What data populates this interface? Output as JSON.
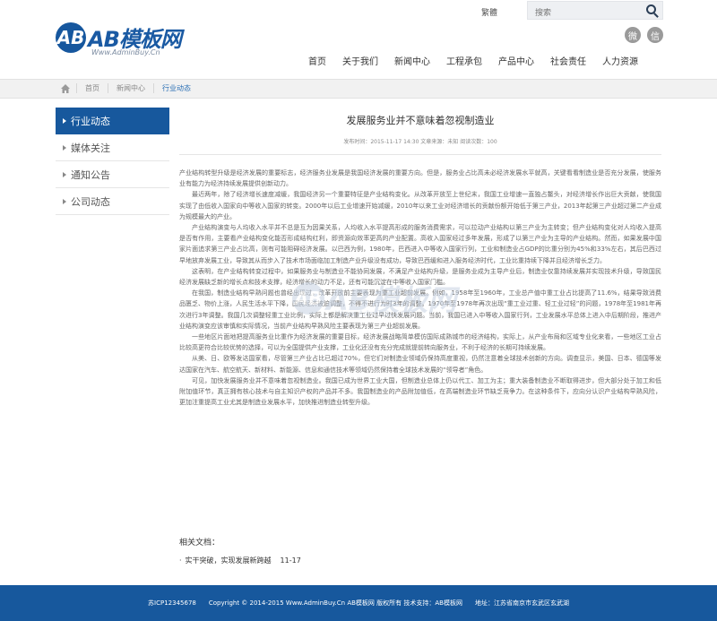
{
  "header": {
    "logo_letters": "AB",
    "logo_text": "AB模板网",
    "logo_sub": "Www.AdminBuy.Cn",
    "lang": "繁體",
    "search_placeholder": "搜索",
    "social_icons": [
      "weibo-icon",
      "wechat-icon"
    ],
    "nav": [
      "首页",
      "关于我们",
      "新闻中心",
      "工程承包",
      "产品中心",
      "社会责任",
      "人力资源"
    ]
  },
  "breadcrumb": [
    "首页",
    "新闻中心",
    "行业动态"
  ],
  "sidebar": {
    "items": [
      "行业动态",
      "媒体关注",
      "通知公告",
      "公司动态"
    ],
    "active_index": 0
  },
  "article": {
    "title": "发展服务业并不意味着忽视制造业",
    "meta": "发布时间：2015-11-17  14:30  文章来源：未知  阅读次数：100",
    "paragraphs": [
      "产业结构转型升级是经济发展的重要标志，经济服务业发展是我国经济发展的重要方向。但是，服务业占比高未必经济发展水平就高，关键看看制造业是否充分发展，使服务业有能力为经济持续发展提供创新动力。",
      "最近两年，除了经济增长速度减缓，我国经济另一个重要特征是产业结构变化。从改革开放至上世纪末，我国工业增速一直独占鳌头，对经济增长作出巨大贡献，使我国实现了由低收入国家向中等收入国家的转变。2000年以后工业增速开始减缓，2010年以来工业对经济增长的贡献份额开始低于第三产业，2013年起第三产业超过第二产业成为规模最大的产业。",
      "产业结构演变与人均收入水平并不总是互为因果关系，人均收入水平提高形成的服务消费需求，可以拉动产业结构以第三产业为主转变；但产业结构变化对人均收入提高是否有作用，主要看产业结构变化能否形成结构红利，即资源向效率更高的产业配置。高收入国家经过多年发展，形成了以第三产业为主导的产业结构。然而，如果发展中国家片面追求第三产业占比高，则有可能阻碍经济发展。以巴西为例，1980年，巴西进入中等收入国家行列，工业和制造业占GDP的比重分别为45%和33%左右，其后巴西过早地放弃发展工业，导致其从而步入了技术市场面临加工制造产业升级没有成功，导致巴西缓和进入服务经济时代，工业比重持续下降并且经济增长乏力。",
      "这表明，在产业结构转变过程中，如果服务业与制造业不能协同发展，不满足产业结构升级，是服务业成为主导产业后，制造业仅靠持续发展并实现技术升级，导致国民经济发展缺乏新的增长点和技术支撑，经济增长的动力不足，还有可能沉淀在中等收入国家门槛。",
      "在我国，制造业结构早熟问题也曾经出现过，改革开放前主要表现为重工业超前发展。例如，1958年至1960年，工业总产值中重工业占比提高了11.6%，结果导致消费品匮乏、物价上涨，人民生活水平下降，国民经济被迫调整，不得不进行为时3年的调整。1970年至1978年再次出现“重工业过重、轻工业过轻”的问题，1978年至1981年再次进行3年调整。我国几次调整轻重工业比例，实际上都是解决重工业过早过快发展问题。当前，我国已进入中等收入国家行列，工业发展水平总体上进入中后期阶段，推进产业结构演变应该审慎和实际情况，当前产业结构早熟风险主要表现为第三产业超前发展。",
      "一些地区片面地把提高服务业比重作为经济发展的重要目标，经济发展战略简单模仿国际成熟城市的经济结构，实际上，从产业布局和区域专业化来看，一些地区工业占比较高更符合比较优势的选择，可以为全国提供产业支撑，工业化还没有充分完成就提前转向服务业，不利于经济的长期可持续发展。",
      "从美、日、欧等发达国家看，尽管第三产业占比已超过70%，但它们对制造业领域仍保持高度重视，仍然注意着全球技术创新的方向。调查显示，美国、日本、德国等发达国家在汽车、航空航天、新材料、新能源、信息和通信技术等领域仍然保持着全球技术发展的“领导者”角色。",
      "可见，加快发展服务业并不意味着忽视制造业。我国已成为世界工业大国，但制造业总体上仍以代工、加工为主；重大装备制造业不断取得进步，但大部分处于加工和低附加值环节，真正拥有核心技术与自主知识产权的产品并不多。我国制造业的产品附加值低，在高端制造业环节缺乏竞争力。在这种条件下，应向分认识产业结构早熟风险，更加注重提高工业尤其是制造业发展水平，加快推进制造业转型升级。"
    ]
  },
  "watermark": {
    "letters": "AB",
    "text": "AB模板网",
    "sub": "Www.AdminBuy.Cn"
  },
  "related": {
    "title": "相关文档：",
    "items": [
      {
        "bullet": "·",
        "text": "实干突破，实现发展新跨越",
        "date": "11-17"
      }
    ]
  },
  "footer": {
    "icp": "苏ICP12345678",
    "copyright": "Copyright © 2014-2015 Www.AdminBuy.Cn AB模板网 版权所有 技术支持：AB模板网",
    "address": "地址：江苏省南京市玄武区玄武湖"
  },
  "colors": {
    "brand": "#17589d",
    "breadbar": "#f1f1f1"
  }
}
